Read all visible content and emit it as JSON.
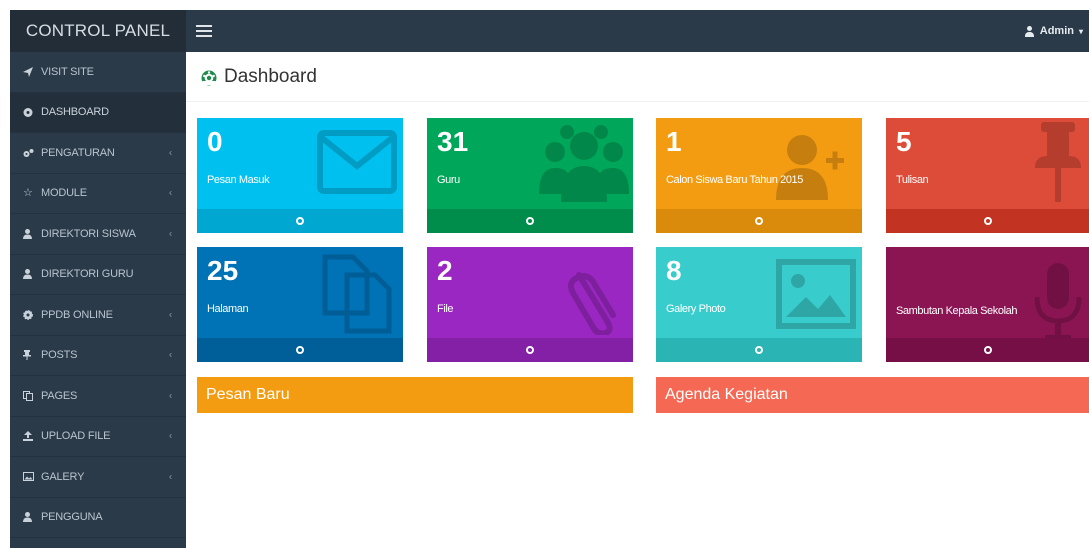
{
  "sidebar": {
    "brand": "CONTROL PANEL",
    "items": [
      {
        "label": "VISIT SITE",
        "icon": "send-icon",
        "chevron": false
      },
      {
        "label": "DASHBOARD",
        "icon": "dashboard-icon",
        "chevron": false,
        "active": true
      },
      {
        "label": "PENGATURAN",
        "icon": "cogs-icon",
        "chevron": true
      },
      {
        "label": "MODULE",
        "icon": "star-icon",
        "chevron": true
      },
      {
        "label": "DIREKTORI SISWA",
        "icon": "user-icon",
        "chevron": true
      },
      {
        "label": "DIREKTORI GURU",
        "icon": "user-icon",
        "chevron": false
      },
      {
        "label": "PPDB ONLINE",
        "icon": "gear-icon",
        "chevron": true
      },
      {
        "label": "POSTS",
        "icon": "pushpin-icon",
        "chevron": true
      },
      {
        "label": "PAGES",
        "icon": "copy-icon",
        "chevron": true
      },
      {
        "label": "UPLOAD FILE",
        "icon": "upload-icon",
        "chevron": true
      },
      {
        "label": "GALERY",
        "icon": "picture-icon",
        "chevron": true
      },
      {
        "label": "PENGGUNA",
        "icon": "user-icon",
        "chevron": false
      }
    ]
  },
  "topbar": {
    "user_label": "Admin"
  },
  "page": {
    "title": "Dashboard"
  },
  "tiles": [
    {
      "count": "0",
      "label": "Pesan Masuk",
      "color": "#00c0ef",
      "footer": "#00a7d0",
      "icon": "envelope-icon"
    },
    {
      "count": "31",
      "label": "Guru",
      "color": "#00a65a",
      "footer": "#008d4c",
      "icon": "users-icon"
    },
    {
      "count": "1",
      "label": "Calon Siswa Baru Tahun 2015",
      "color": "#f39c12",
      "footer": "#db8b0b",
      "icon": "user-plus-icon"
    },
    {
      "count": "5",
      "label": "Tulisan",
      "color": "#dd4b39",
      "footer": "#c23321",
      "icon": "pushpin-icon"
    },
    {
      "count": "25",
      "label": "Halaman",
      "color": "#0073b7",
      "footer": "#005f99",
      "icon": "files-icon"
    },
    {
      "count": "2",
      "label": "File",
      "color": "#9b27c2",
      "footer": "#8320a5",
      "icon": "paperclip-icon"
    },
    {
      "count": "8",
      "label": "Galery Photo",
      "color": "#39cccc",
      "footer": "#2ab4b4",
      "icon": "picture-icon"
    },
    {
      "count": "",
      "label": "Sambutan Kepala Sekolah",
      "color": "#8b1553",
      "footer": "#760f45",
      "icon": "microphone-icon"
    }
  ],
  "panels": {
    "pesan_baru": {
      "title": "Pesan Baru",
      "color": "#f39c12"
    },
    "agenda": {
      "title": "Agenda Kegiatan",
      "color": "#f56954"
    }
  }
}
